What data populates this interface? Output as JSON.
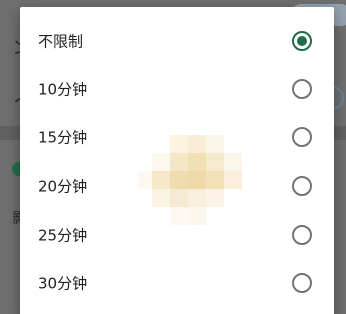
{
  "dialog": {
    "options": [
      {
        "label": "不限制",
        "selected": true
      },
      {
        "label": "10分钟",
        "selected": false
      },
      {
        "label": "15分钟",
        "selected": false
      },
      {
        "label": "20分钟",
        "selected": false
      },
      {
        "label": "25分钟",
        "selected": false
      },
      {
        "label": "30分钟",
        "selected": false
      }
    ]
  },
  "background": {
    "edge_glyphs": [
      "ン",
      "ノ",
      "影"
    ]
  },
  "colors": {
    "accent": "#1e6e4a",
    "radio_unchecked": "#737373",
    "scrim": "#6f6f6f"
  }
}
